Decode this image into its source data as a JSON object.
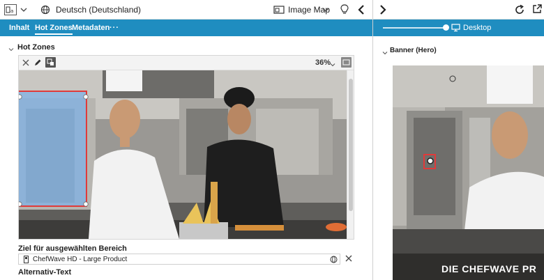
{
  "toolbar": {
    "language": "Deutsch (Deutschland)",
    "view_mode": "Image Map"
  },
  "tabs": [
    "Inhalt",
    "Hot Zones",
    "Metadaten",
    "···"
  ],
  "active_tab": "Hot Zones",
  "section": {
    "title": "Hot Zones"
  },
  "editor": {
    "zoom": "36%"
  },
  "target": {
    "label": "Ziel für ausgewählten Bereich",
    "value": "ChefWave HD - Large Product"
  },
  "alt_text": {
    "label": "Alternativ-Text"
  },
  "preview": {
    "device": "Desktop",
    "section_title": "Banner (Hero)",
    "banner_text": "DIE CHEFWAVE PR"
  },
  "colors": {
    "accent": "#1f8dc0",
    "hotzone_border": "#e03a3a",
    "hotzone_fill": "#7fb2e5"
  }
}
